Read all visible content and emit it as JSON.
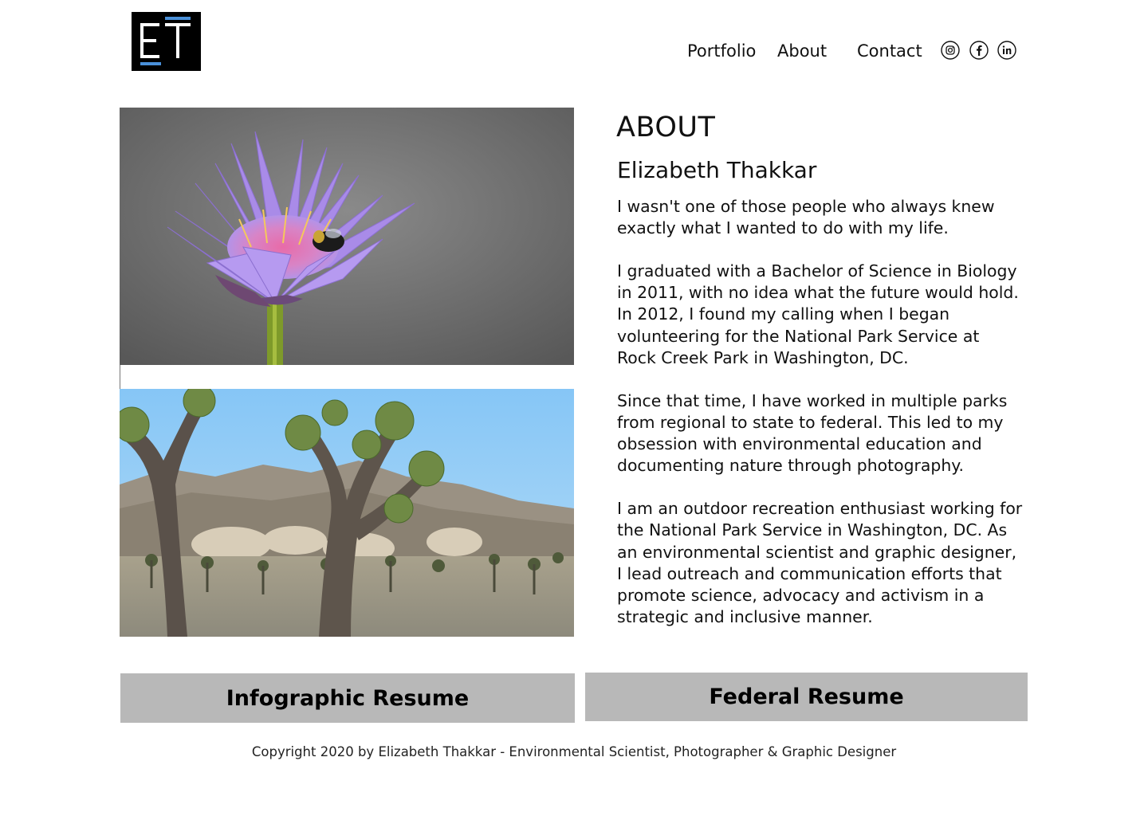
{
  "logo": {
    "text": "ET",
    "accent": "#4a90d9"
  },
  "nav": {
    "items": [
      {
        "label": "Portfolio"
      },
      {
        "label": "About"
      },
      {
        "label": "Contact"
      }
    ],
    "social": [
      {
        "icon": "instagram-icon"
      },
      {
        "icon": "facebook-icon"
      },
      {
        "icon": "linkedin-icon"
      }
    ]
  },
  "photos": [
    {
      "subject": "purple water lily with bee"
    },
    {
      "subject": "joshua trees desert landscape"
    }
  ],
  "about": {
    "heading": "ABOUT",
    "name": "Elizabeth Thakkar",
    "paragraphs": [
      "I wasn't one of those people who always knew\nexactly what I wanted to do with my life.",
      "I graduated with a Bachelor of Science in Biology\nin 2011, with no idea what the future would hold.\nIn 2012, I found my calling when I began\nvolunteering for the National Park Service at\nRock Creek Park in Washington, DC.",
      "Since that time, I have worked in multiple parks\nfrom regional to state to federal. This led to my\nobsession with environmental education and\ndocumenting nature through photography.",
      "I am an outdoor recreation enthusiast working for\nthe National Park Service in Washington, DC. As\nan environmental scientist and graphic designer,\nI lead outreach and communication efforts that\npromote science, advocacy and activism in a\nstrategic and inclusive manner."
    ]
  },
  "buttons": {
    "infographic": "Infographic Resume",
    "federal": "Federal Resume"
  },
  "footer": {
    "copyright": "Copyright 2020 by Elizabeth Thakkar - Environmental Scientist, Photographer & Graphic Designer"
  },
  "colors": {
    "button_bg": "#b8b8b8",
    "logo_bg": "#000000",
    "logo_accent": "#4a90d9"
  }
}
